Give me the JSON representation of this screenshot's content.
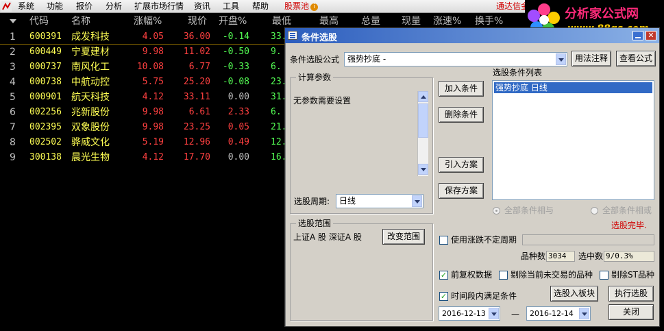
{
  "menubar": {
    "items": [
      "系统",
      "功能",
      "报价",
      "分析",
      "扩展市场行情",
      "资讯",
      "工具",
      "帮助"
    ],
    "pool_label": "股票池",
    "pool_badge": "i",
    "broker_label": "通达信金"
  },
  "watermark": {
    "title": "分析家公式网",
    "url": "www.88gs.com"
  },
  "quote_table": {
    "headers": [
      "代码",
      "名称",
      "涨幅%",
      "现价",
      "开盘%",
      "最低",
      "最高",
      "总量",
      "现量",
      "涨速%",
      "换手%"
    ],
    "rows": [
      {
        "idx": "1",
        "code": "600391",
        "name": "成发科技",
        "pct": "4.05",
        "price": "36.00",
        "open": "-0.14",
        "low": "33."
      },
      {
        "idx": "2",
        "code": "600449",
        "name": "宁夏建材",
        "pct": "9.98",
        "price": "11.02",
        "open": "-0.50",
        "low": "9."
      },
      {
        "idx": "3",
        "code": "000737",
        "name": "南风化工",
        "pct": "10.08",
        "price": "6.77",
        "open": "-0.33",
        "low": "6."
      },
      {
        "idx": "4",
        "code": "000738",
        "name": "中航动控",
        "pct": "5.75",
        "price": "25.20",
        "open": "-0.08",
        "low": "23."
      },
      {
        "idx": "5",
        "code": "000901",
        "name": "航天科技",
        "pct": "4.12",
        "price": "33.11",
        "open": "0.00",
        "low": "31."
      },
      {
        "idx": "6",
        "code": "002256",
        "name": "兆新股份",
        "pct": "9.98",
        "price": "6.61",
        "open": "2.33",
        "low": "6."
      },
      {
        "idx": "7",
        "code": "002395",
        "name": "双象股份",
        "pct": "9.98",
        "price": "23.25",
        "open": "0.05",
        "low": "21."
      },
      {
        "idx": "8",
        "code": "002502",
        "name": "骅威文化",
        "pct": "5.19",
        "price": "12.96",
        "open": "0.49",
        "low": "12."
      },
      {
        "idx": "9",
        "code": "300138",
        "name": "晨光生物",
        "pct": "4.12",
        "price": "17.70",
        "open": "0.00",
        "low": "16."
      }
    ],
    "colors": {
      "up": "#ff4040",
      "down": "#54ff54",
      "flat": "#c0c0c0",
      "name": "#ffff54"
    }
  },
  "dialog": {
    "title": "条件选股",
    "formula_label": "条件选股公式",
    "formula_value": "强势抄底          -",
    "btn_usage": "用法注释",
    "btn_view": "查看公式",
    "params_group": "计算参数",
    "params_text": "无参数需要设置",
    "period_label": "选股周期:",
    "period_value": "日线",
    "btn_add": "加入条件",
    "btn_delete": "删除条件",
    "btn_import": "引入方案",
    "btn_save": "保存方案",
    "cond_list_label": "选股条件列表",
    "cond_item": "强势抄底    日线",
    "radio_all_and": "全部条件相与",
    "radio_all_or": "全部条件相或",
    "status": "选股完毕.",
    "range_group": "选股范围",
    "range_text": "上证A 股  深证A 股",
    "btn_change_range": "改变范围",
    "chk_limit_period": "使用涨跌不定周期",
    "count_label": "品种数",
    "count_value": "3034",
    "selected_label": "选中数",
    "selected_value": "9/0.3%",
    "chk_prefq": "前复权数据",
    "chk_exclude_untraded": "剔除当前未交易的品种",
    "chk_exclude_st": "剔除ST品种",
    "chk_time_range": "时间段内满足条件",
    "btn_to_block": "选股入板块",
    "btn_execute": "执行选股",
    "date_from": "2016-12-13",
    "date_sep": "—",
    "date_to": "2016-12-14",
    "btn_close": "关闭"
  }
}
